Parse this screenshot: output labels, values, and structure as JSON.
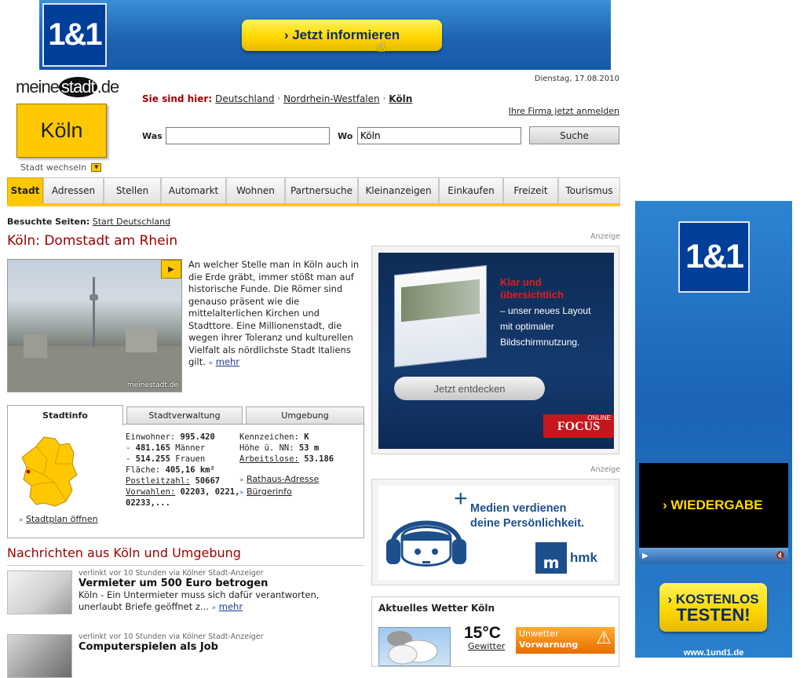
{
  "top_banner": {
    "brand": "1&1",
    "cta": "› Jetzt informieren"
  },
  "header": {
    "date": "Dienstag, 17.08.2010",
    "logo_part1": "meine",
    "logo_part2": "stadt",
    "logo_part3": ".de",
    "city": "Köln",
    "change_city": "Stadt wechseln",
    "breadcrumb_label": "Sie sind hier:",
    "breadcrumb": [
      "Deutschland",
      "Nordrhein-Westfalen",
      "Köln"
    ],
    "company_link": "Ihre Firma jetzt anmelden"
  },
  "search": {
    "was_label": "Was",
    "was_value": "",
    "wo_label": "Wo",
    "wo_value": "Köln",
    "button": "Suche"
  },
  "nav": {
    "tabs": [
      {
        "label": "Stadt",
        "active": true
      },
      {
        "label": "Adressen",
        "active": false
      },
      {
        "label": "Stellen",
        "active": false
      },
      {
        "label": "Automarkt",
        "active": false
      },
      {
        "label": "Wohnen",
        "active": false
      },
      {
        "label": "Partnersuche",
        "active": false
      },
      {
        "label": "Kleinanzeigen",
        "active": false
      },
      {
        "label": "Einkaufen",
        "active": false
      },
      {
        "label": "Freizeit",
        "active": false
      },
      {
        "label": "Tourismus",
        "active": false
      }
    ]
  },
  "visited": {
    "label": "Besuchte Seiten:",
    "link": "Start Deutschland"
  },
  "main": {
    "title": "Köln: Domstadt am Rhein",
    "photo_watermark": "meinestadt.de",
    "intro": "An welcher Stelle man in Köln auch in die Erde gräbt, immer stößt man auf historische Funde. Die Römer sind genauso präsent wie die mittelalterlichen Kirchen und Stadttore. Eine Millionenstadt, die wegen ihrer Toleranz und kulturellen Vielfalt als nördlichste Stadt Italiens gilt.",
    "intro_more": "mehr"
  },
  "info": {
    "tabs": [
      "Stadtinfo",
      "Stadtverwaltung",
      "Umgebung"
    ],
    "residents_label": "Einwohner:",
    "residents": "995.420",
    "men": "481.165",
    "men_label": "Männer",
    "women": "514.255",
    "women_label": "Frauen",
    "area_label": "Fläche:",
    "area": "405,16 km²",
    "zip_label": "Postleitzahl:",
    "zip": "50667",
    "dial_label": "Vorwahlen:",
    "dial": "02203, 0221,",
    "dial2": "02233,...",
    "plate_label": "Kennzeichen:",
    "plate": "K",
    "altitude_label": "Höhe ü. NN:",
    "altitude": "53 m",
    "unemployed_label": "Arbeitslose:",
    "unemployed": "53.186",
    "town_hall": "Rathaus-Adresse",
    "citizen_info": "Bürgerinfo",
    "map_link": "Stadtplan öffnen"
  },
  "news": {
    "title": "Nachrichten aus Köln und Umgebung",
    "items": [
      {
        "meta": "verlinkt vor 10 Stunden via Kölner Stadt-Anzeiger",
        "headline": "Vermieter um 500 Euro betrogen",
        "text": "Köln - Ein Untermieter muss sich dafür verantworten, unerlaubt Briefe geöffnet z...",
        "more": "mehr"
      },
      {
        "meta": "verlinkt vor 10 Stunden via Kölner Stadt-Anzeiger",
        "headline": "Computerspielen als Job",
        "text": "",
        "more": ""
      }
    ]
  },
  "ads": {
    "label": "Anzeige",
    "focus_headline_1": "Klar und",
    "focus_headline_2": "übersichtlich",
    "focus_text_1": "– unser neues Layout",
    "focus_text_2": "mit optimaler",
    "focus_text_3": "Bildschirmnutzung.",
    "focus_button": "Jetzt entdecken",
    "focus_logo_small": "ONLINE",
    "focus_logo_big": "FOCUS",
    "hmk_line_1": "Medien verdienen",
    "hmk_line_2": "deine Persönlichkeit.",
    "hmk_logo": "hmk",
    "hmk_logo_m": "m"
  },
  "weather": {
    "title": "Aktuelles Wetter Köln",
    "temp": "15°C",
    "condition": "Gewitter",
    "warning_1": "Unwetter",
    "warning_2": "Vorwarnung"
  },
  "sky_ad": {
    "brand": "1&1",
    "video_label": "› WIEDERGABE",
    "button_line_1": "› KOSTENLOS",
    "button_line_2": "TESTEN!",
    "url": "www.1und1.de"
  },
  "colors": {
    "accent_yellow": "#ffc800",
    "title_red": "#a00000",
    "brand_blue": "#003f99"
  }
}
